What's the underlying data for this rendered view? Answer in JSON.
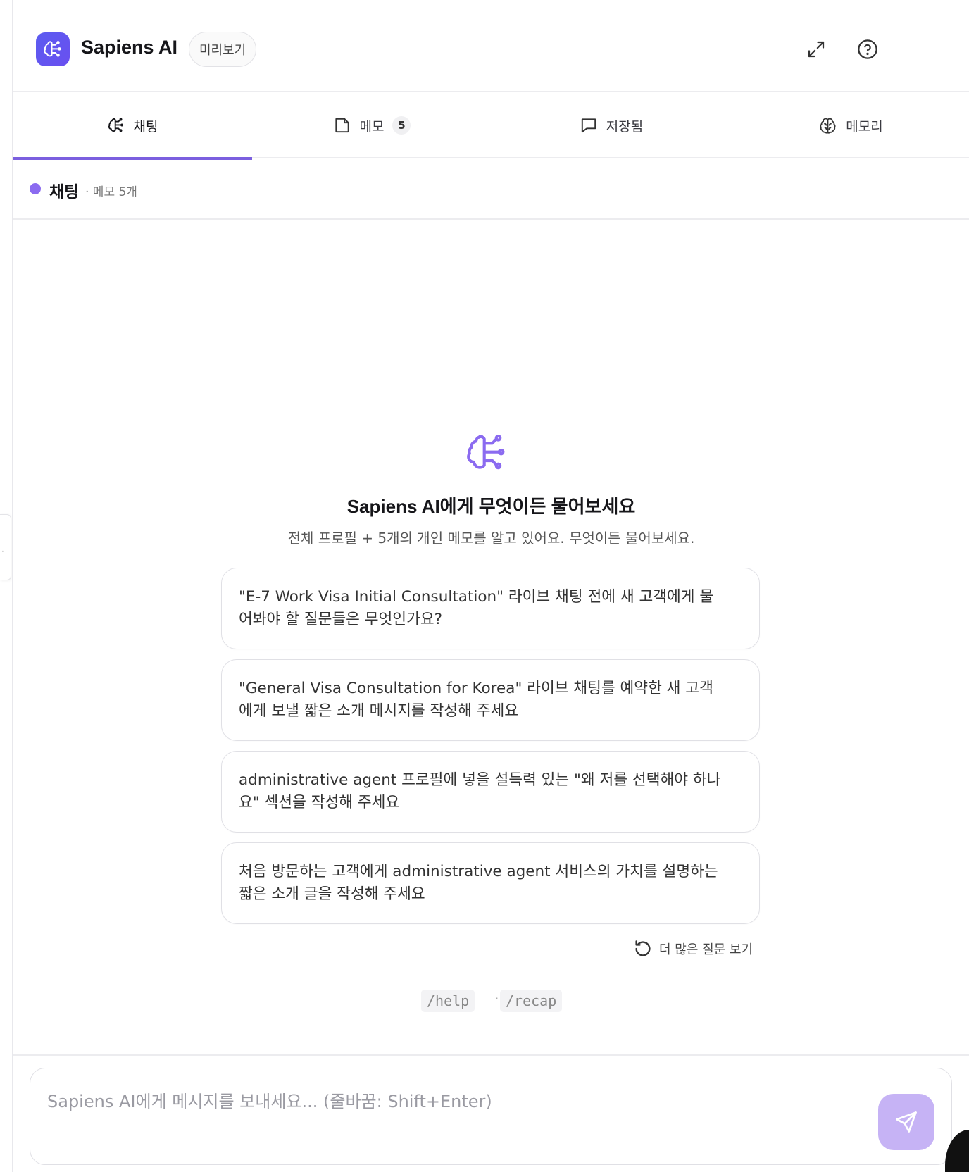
{
  "app": {
    "title": "Sapiens AI",
    "badge": "미리보기",
    "icons": {
      "logo": "brain-icon",
      "expand": "expand-icon",
      "help": "help-circle-icon"
    }
  },
  "tabs": [
    {
      "label": "채팅",
      "icon": "brain-icon",
      "active": true
    },
    {
      "label": "메모",
      "icon": "note-icon",
      "count": "5"
    },
    {
      "label": "저장됨",
      "icon": "chat-bubble-icon"
    },
    {
      "label": "메모리",
      "icon": "memory-brain-icon"
    }
  ],
  "subheader": {
    "title": "채팅",
    "meta": "· 메모 5개"
  },
  "empty_state": {
    "title": "Sapiens AI에게 무엇이든 물어보세요",
    "subtitle": "전체 프로필 + 5개의 개인 메모를 알고 있어요. 무엇이든 물어보세요."
  },
  "suggestions": [
    {
      "line1": "\"E-7 Work Visa Initial Consultation\" 라이브 채팅 전에 새 고객에게 물",
      "line2": "어봐야 할 질문들은 무엇인가요?"
    },
    {
      "line1": "\"General Visa Consultation for Korea\" 라이브 채팅를 예약한 새 고객",
      "line2": "에게 보낼 짧은 소개 메시지를 작성해 주세요"
    },
    {
      "line1": "administrative agent 프로필에 넣을 설득력 있는 \"왜 저를 선택해야 하나",
      "line2": "요\" 섹션을 작성해 주세요"
    },
    {
      "line1": "처음 방문하는 고객에게 administrative agent 서비스의 가치를 설명하는",
      "line2": "짧은 소개 글을 작성해 주세요"
    }
  ],
  "more_questions": "더 많은 질문 보기",
  "commands": [
    "/help",
    "·",
    "/recap"
  ],
  "composer": {
    "placeholder": "Sapiens AI에게 메시지를 보내세요... (줄바꿈: Shift+Enter)",
    "value": ""
  },
  "colors": {
    "accent": "#7b5fdf",
    "logo_bg": "#5b5cf0",
    "send_button": "#c6b3f5"
  }
}
